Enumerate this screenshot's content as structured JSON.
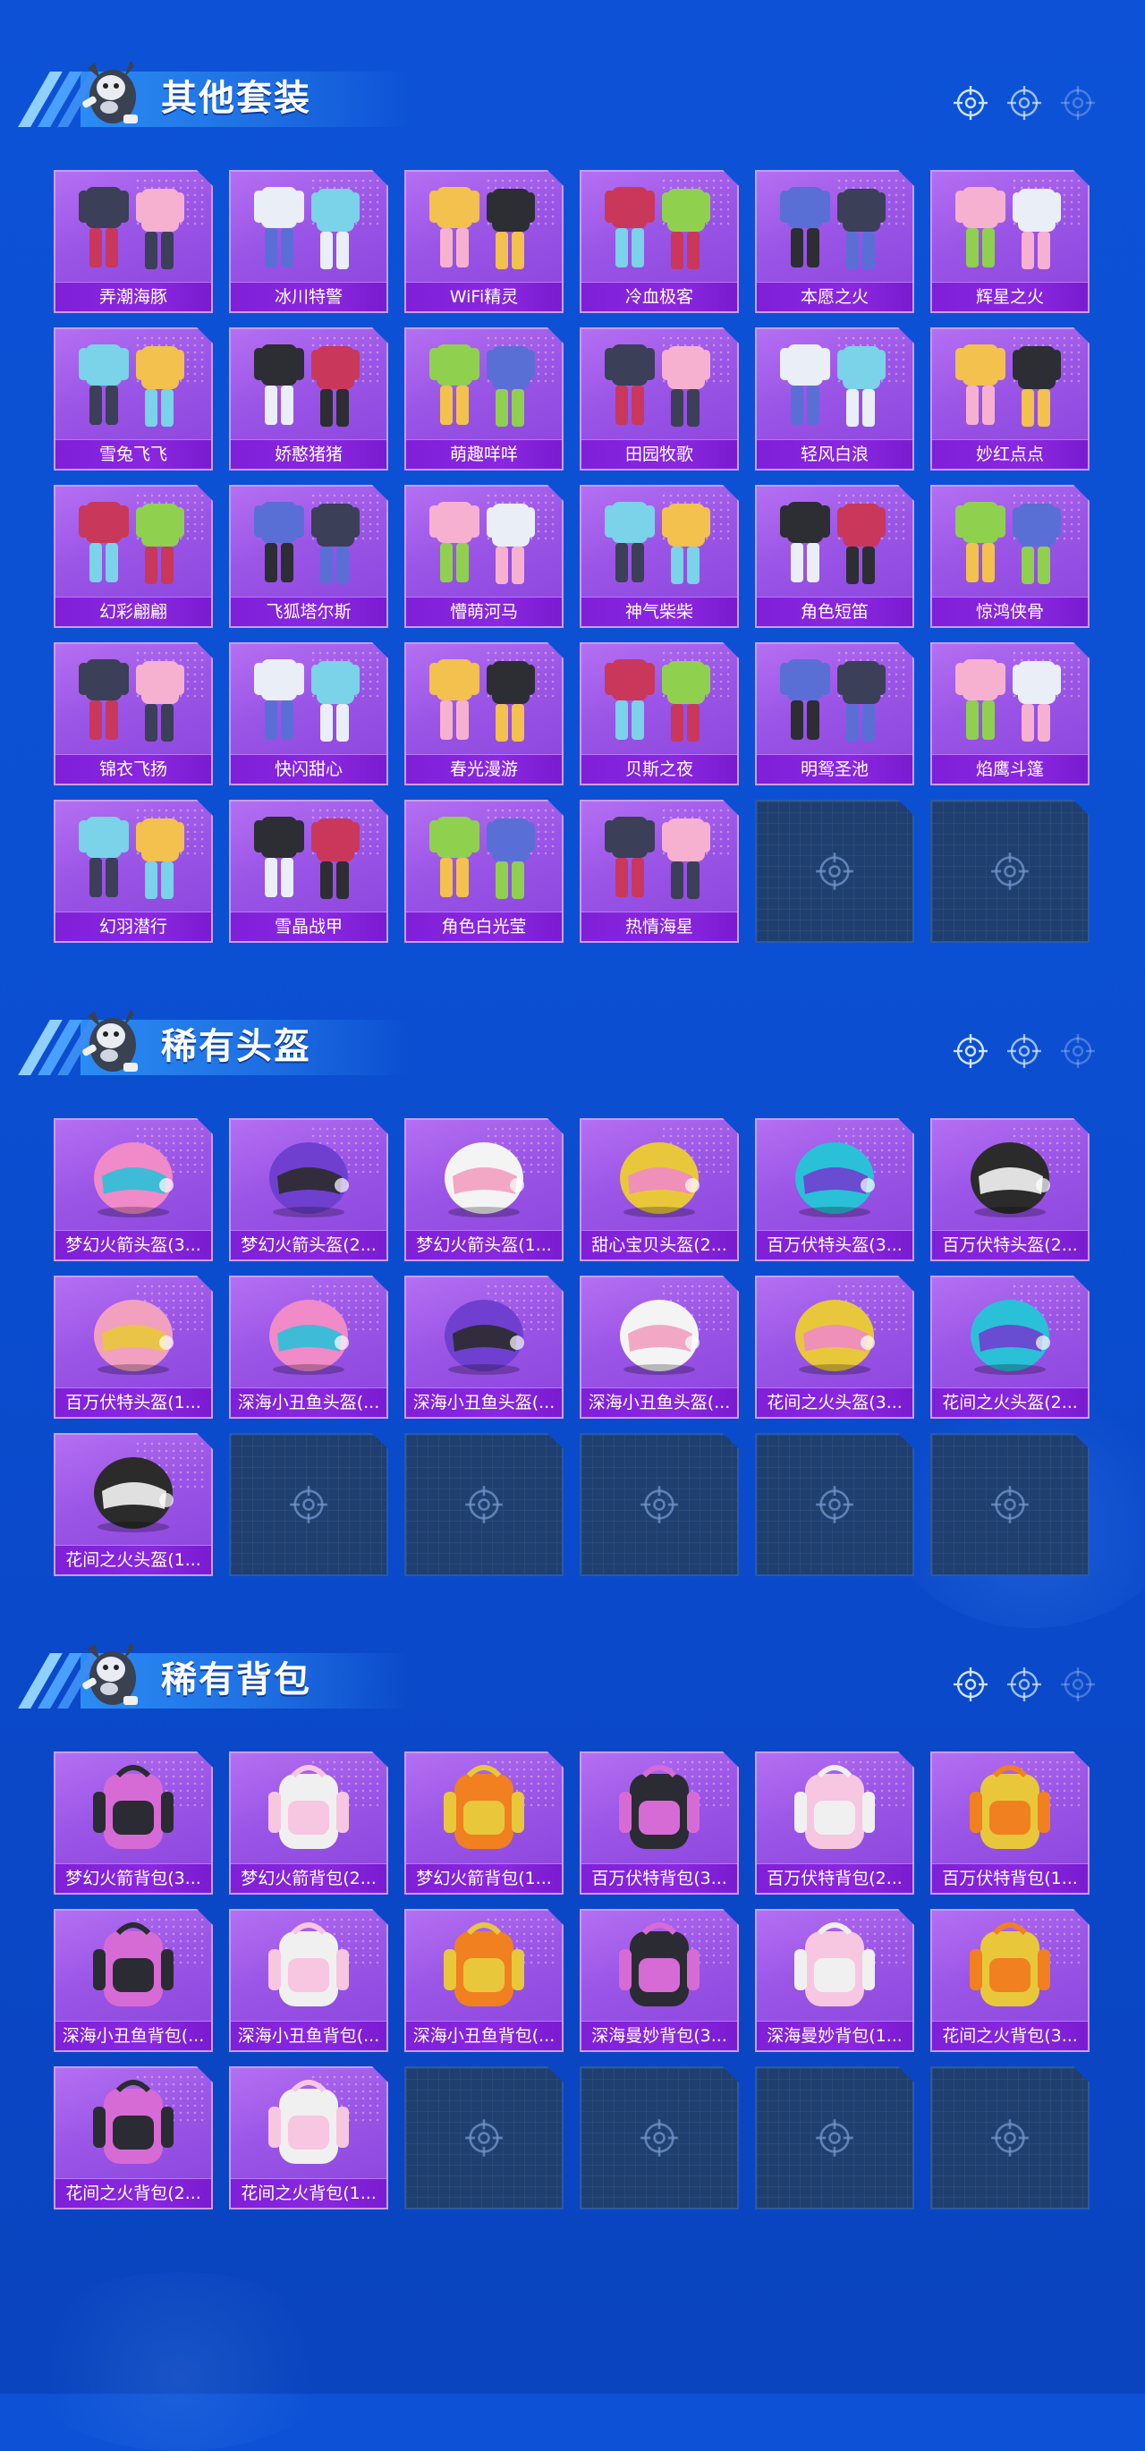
{
  "colors": {
    "background": "#0b4fd2",
    "card": "#9a54e6",
    "label_bar": "#8024da",
    "empty_slot": "#1f3f70"
  },
  "sections": [
    {
      "title": "其他套装",
      "icon": "mascot-icon",
      "items": [
        "弄潮海豚",
        "冰川特警",
        "WiFi精灵",
        "冷血极客",
        "本愿之火",
        "辉星之火",
        "雪兔飞飞",
        "娇憨猪猪",
        "萌趣咩咩",
        "田园牧歌",
        "轻风白浪",
        "妙红点点",
        "幻彩翩翩",
        "飞狐塔尔斯",
        "懵萌河马",
        "神气柴柴",
        "角色短笛",
        "惊鸿侠骨",
        "锦衣飞扬",
        "快闪甜心",
        "春光漫游",
        "贝斯之夜",
        "明鸳圣池",
        "焰鹰斗篷",
        "幻羽潜行",
        "雪晶战甲",
        "角色白光莹",
        "热情海星"
      ],
      "empty_slots": 2
    },
    {
      "title": "稀有头盔",
      "icon": "mascot-icon",
      "items": [
        "梦幻火箭头盔(3...",
        "梦幻火箭头盔(2...",
        "梦幻火箭头盔(1...",
        "甜心宝贝头盔(2...",
        "百万伏特头盔(3...",
        "百万伏特头盔(2...",
        "百万伏特头盔(1...",
        "深海小丑鱼头盔(...",
        "深海小丑鱼头盔(...",
        "深海小丑鱼头盔(...",
        "花间之火头盔(3...",
        "花间之火头盔(2...",
        "花间之火头盔(1..."
      ],
      "empty_slots": 5
    },
    {
      "title": "稀有背包",
      "icon": "mascot-icon",
      "items": [
        "梦幻火箭背包(3...",
        "梦幻火箭背包(2...",
        "梦幻火箭背包(1...",
        "百万伏特背包(3...",
        "百万伏特背包(2...",
        "百万伏特背包(1...",
        "深海小丑鱼背包(...",
        "深海小丑鱼背包(...",
        "深海小丑鱼背包(...",
        "深海曼妙背包(3...",
        "深海曼妙背包(1...",
        "花间之火背包(3...",
        "花间之火背包(2...",
        "花间之火背包(1..."
      ],
      "empty_slots": 4
    }
  ]
}
